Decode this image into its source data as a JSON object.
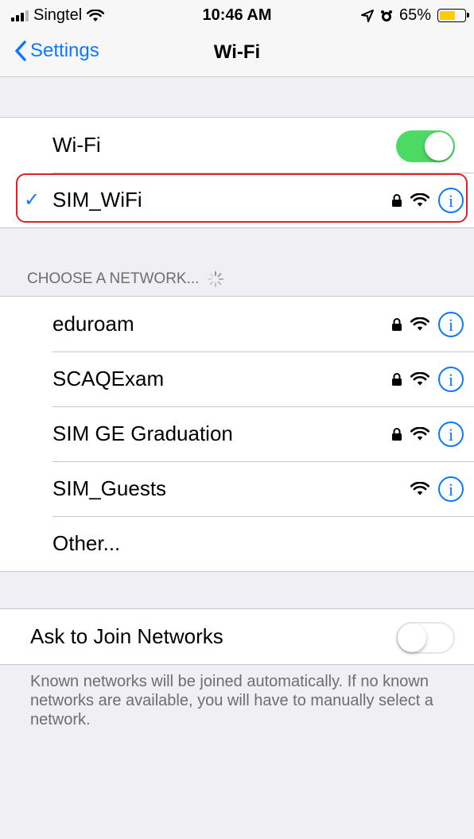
{
  "status_bar": {
    "carrier": "Singtel",
    "time": "10:46 AM",
    "battery": "65%",
    "battery_level": 0.65,
    "icons": [
      "signal-icon",
      "wifi-icon",
      "location-icon",
      "alarm-icon",
      "battery-icon"
    ]
  },
  "nav": {
    "back_label": "Settings",
    "title": "Wi-Fi"
  },
  "wifi": {
    "label": "Wi-Fi",
    "enabled": true
  },
  "connected": {
    "check": "✓",
    "name": "SIM_WiFi",
    "secured": true
  },
  "choose_header": "CHOOSE A NETWORK...",
  "networks": [
    {
      "name": "eduroam",
      "secured": true
    },
    {
      "name": "SCAQExam",
      "secured": true
    },
    {
      "name": "SIM GE Graduation",
      "secured": true
    },
    {
      "name": "SIM_Guests",
      "secured": false
    }
  ],
  "other_label": "Other...",
  "ask_join": {
    "label": "Ask to Join Networks",
    "enabled": false,
    "footer": "Known networks will be joined automatically. If no known networks are available, you will have to manually select a network."
  },
  "colors": {
    "accent": "#0a7aff",
    "toggle_on": "#4cd964",
    "highlight": "#e0212b",
    "battery": "#ffcc00"
  }
}
